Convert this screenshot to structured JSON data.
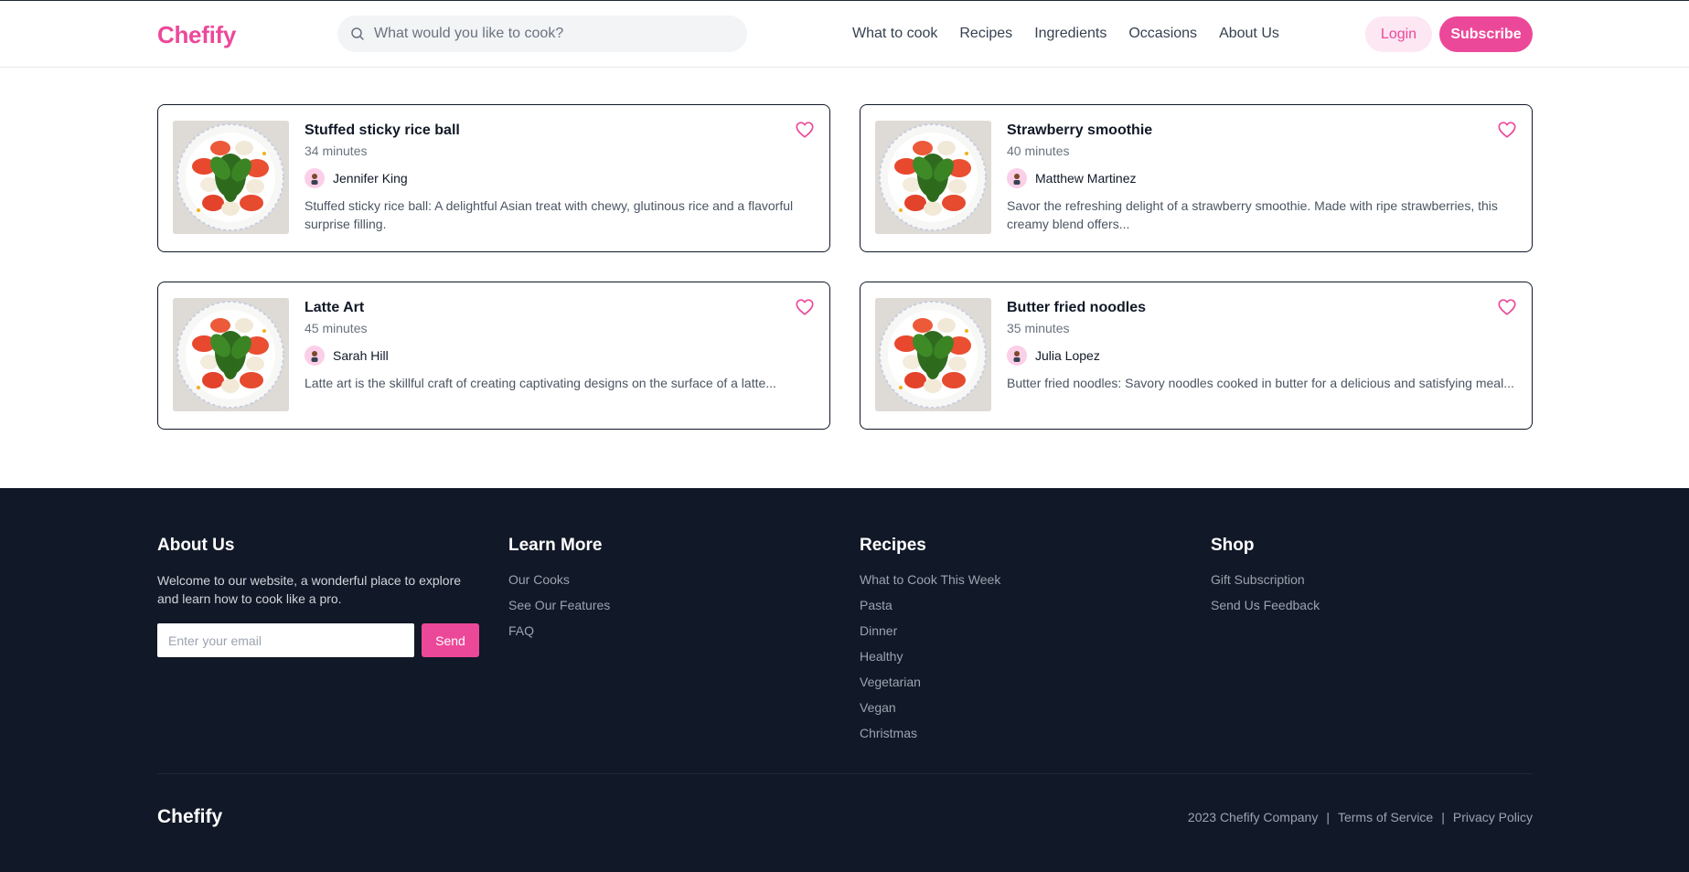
{
  "header": {
    "logo": "Chefify",
    "search_placeholder": "What would you like to cook?",
    "nav": [
      "What to cook",
      "Recipes",
      "Ingredients",
      "Occasions",
      "About Us"
    ],
    "login_label": "Login",
    "subscribe_label": "Subscribe"
  },
  "recipes": [
    {
      "title": "Stuffed sticky rice ball",
      "time": "34 minutes",
      "author": "Jennifer King",
      "description": "Stuffed sticky rice ball: A delightful Asian treat with chewy, glutinous rice and a flavorful surprise filling."
    },
    {
      "title": "Strawberry smoothie",
      "time": "40 minutes",
      "author": "Matthew Martinez",
      "description": "Savor the refreshing delight of a strawberry smoothie. Made with ripe strawberries, this creamy blend offers..."
    },
    {
      "title": "Latte Art",
      "time": "45 minutes",
      "author": "Sarah Hill",
      "description": "Latte art is the skillful craft of creating captivating designs on the surface of a latte..."
    },
    {
      "title": "Butter fried noodles",
      "time": "35 minutes",
      "author": "Julia Lopez",
      "description": "Butter fried noodles: Savory noodles cooked in butter for a delicious and satisfying meal..."
    }
  ],
  "footer": {
    "about": {
      "heading": "About Us",
      "text": "Welcome to our website, a wonderful place to explore and learn how to cook like a pro.",
      "email_placeholder": "Enter your email",
      "send_label": "Send"
    },
    "learn_more": {
      "heading": "Learn More",
      "links": [
        "Our Cooks",
        "See Our Features",
        "FAQ"
      ]
    },
    "recipes": {
      "heading": "Recipes",
      "links": [
        "What to Cook This Week",
        "Pasta",
        "Dinner",
        "Healthy",
        "Vegetarian",
        "Vegan",
        "Christmas"
      ]
    },
    "shop": {
      "heading": "Shop",
      "links": [
        "Gift Subscription",
        "Send Us Feedback"
      ]
    },
    "logo": "Chefify",
    "copyright": "2023 Chefify Company",
    "terms": "Terms of Service",
    "privacy": "Privacy Policy",
    "separator": "|"
  },
  "colors": {
    "brand": "#ec4899",
    "brand_light": "#fce7f3",
    "footer_bg": "#111827"
  },
  "icons": {
    "search": "search-icon",
    "heart": "heart-icon",
    "avatar": "avatar"
  }
}
